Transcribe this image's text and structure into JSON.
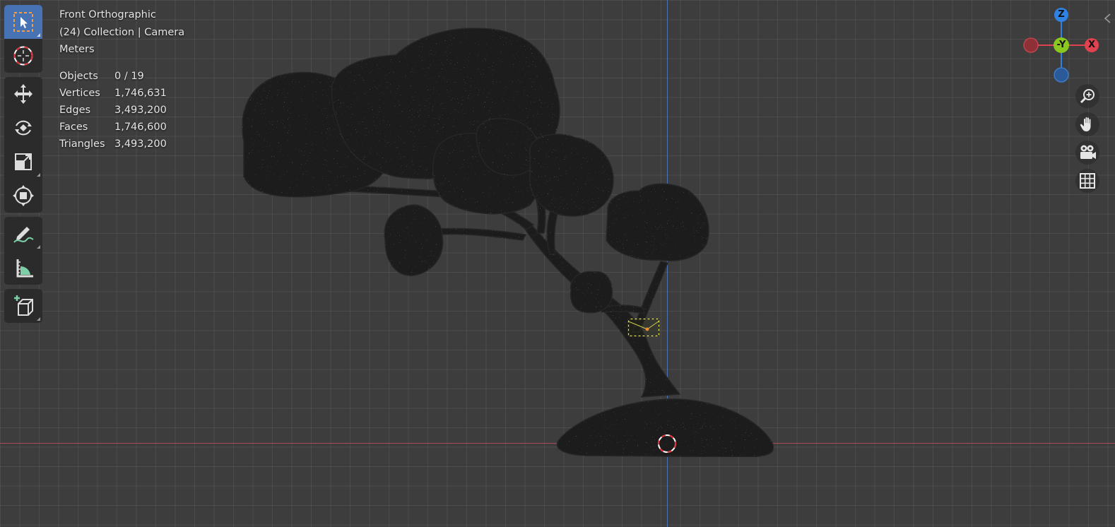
{
  "viewport": {
    "view_name": "Front Orthographic",
    "collection": "(24) Collection | Camera",
    "units": "Meters"
  },
  "stats": [
    {
      "label": "Objects",
      "value": "0 / 19"
    },
    {
      "label": "Vertices",
      "value": "1,746,631"
    },
    {
      "label": "Edges",
      "value": "3,493,200"
    },
    {
      "label": "Faces",
      "value": "1,746,600"
    },
    {
      "label": "Triangles",
      "value": "3,493,200"
    }
  ],
  "toolbar": {
    "tools": [
      {
        "id": "select-box",
        "icon": "select-box-icon",
        "active": true
      },
      {
        "id": "cursor",
        "icon": "3d-cursor-icon",
        "active": false
      },
      {
        "id": "move",
        "icon": "move-icon",
        "active": false
      },
      {
        "id": "rotate",
        "icon": "rotate-icon",
        "active": false
      },
      {
        "id": "scale",
        "icon": "scale-icon",
        "active": false
      },
      {
        "id": "transform",
        "icon": "transform-icon",
        "active": false
      },
      {
        "id": "annotate",
        "icon": "annotate-icon",
        "active": false
      },
      {
        "id": "measure",
        "icon": "measure-icon",
        "active": false
      },
      {
        "id": "add-cube",
        "icon": "add-cube-icon",
        "active": false
      }
    ]
  },
  "gizmo": {
    "z_label": "Z",
    "y_label": "-Y",
    "x_label": "X",
    "colors": {
      "x": "#e0424f",
      "y": "#8bc81f",
      "z": "#2f82e2"
    }
  },
  "navigation": [
    {
      "id": "zoom",
      "icon": "zoom-icon"
    },
    {
      "id": "pan",
      "icon": "hand-pan-icon"
    },
    {
      "id": "camera",
      "icon": "camera-view-icon"
    },
    {
      "id": "ortho",
      "icon": "orthographic-grid-icon"
    }
  ],
  "colors": {
    "background": "#3d3d3d",
    "grid": "#4a4a4a",
    "x_axis": "#a84c55",
    "z_axis": "#4a74b8",
    "active_tool": "#4772b3",
    "selection_yellow": "#e8e85a"
  }
}
